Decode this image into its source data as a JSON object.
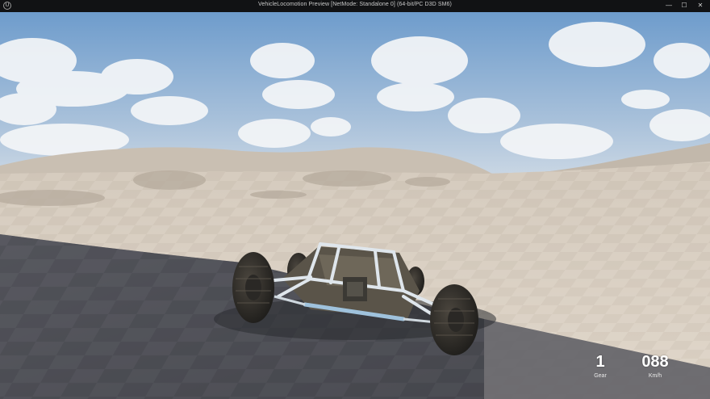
{
  "window": {
    "title": "VehicleLocomotion Preview [NetMode: Standalone 0]  (64-bit/PC D3D SM6)",
    "logo_icon": "unreal-engine-logo",
    "controls": {
      "minimize": "—",
      "maximize": "☐",
      "close": "✕"
    }
  },
  "hud": {
    "gear_value": "1",
    "gear_label": "Gear",
    "speed_value": "088",
    "speed_label": "Km/h"
  },
  "scene": {
    "description_colors": {
      "sky_top": "#6f9fcf",
      "sky_horizon": "#c9d8e6",
      "sand": "#d3c7b8",
      "shadow_floor": "#4a4b50"
    }
  }
}
